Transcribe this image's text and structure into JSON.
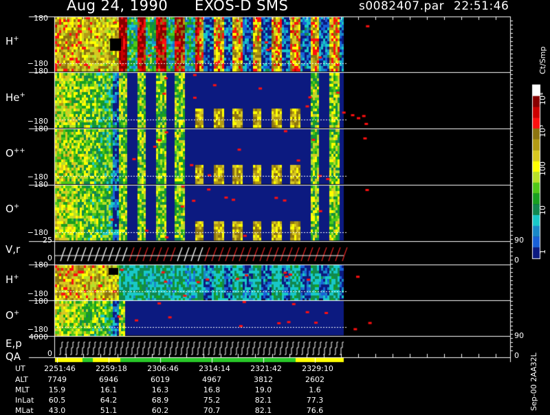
{
  "header": {
    "date": "Aug 24, 1990",
    "instrument": "EXOS-D SMS",
    "file": "s0082407.par",
    "time": "22:51:46"
  },
  "panels": [
    {
      "base": "H",
      "sup": "+",
      "top_tick": "180",
      "bottom_tick": "−180"
    },
    {
      "base": "He",
      "sup": "+",
      "top_tick": "180",
      "bottom_tick": "−180"
    },
    {
      "base": "O",
      "sup": "++",
      "top_tick": "180",
      "bottom_tick": "−180"
    },
    {
      "base": "O",
      "sup": "+",
      "top_tick": "180",
      "bottom_tick": "−180"
    },
    {
      "base": "V,r",
      "sup": "",
      "top_tick": "25",
      "bottom_tick": "0",
      "right_top": "90",
      "right_bottom": "0"
    },
    {
      "base": "H",
      "sup": "+",
      "top_tick": "180",
      "bottom_tick": "−180"
    },
    {
      "base": "O",
      "sup": "+",
      "top_tick": "180",
      "bottom_tick": "−180"
    },
    {
      "base": "E,p",
      "sub": "QA",
      "top_tick": "4000",
      "bottom_tick": "0",
      "right_top": "90",
      "right_bottom": "0"
    }
  ],
  "colorbar": {
    "unit": "Ct/Smp",
    "ticks": [
      "10⁴",
      "10³",
      "100",
      "10",
      "1"
    ],
    "colors": [
      "#ffffff",
      "#880000",
      "#cc0000",
      "#ff1010",
      "#8c7410",
      "#b29a14",
      "#d8c820",
      "#ffff00",
      "#b8e028",
      "#50c818",
      "#18a020",
      "#118850",
      "#18c8c8",
      "#1888c8",
      "#1860d8",
      "#0c1a80"
    ]
  },
  "side_label": "Sep-00  2AA32L",
  "table": {
    "rows": [
      {
        "label": "UT",
        "values": [
          "2251:46",
          "2259:18",
          "2306:46",
          "2314:14",
          "2321:42",
          "2329:10"
        ]
      },
      {
        "label": "ALT",
        "values": [
          "7749",
          "6946",
          "6019",
          "4967",
          "3812",
          "2602"
        ]
      },
      {
        "label": "MLT",
        "values": [
          "15.9",
          "16.1",
          "16.3",
          "16.8",
          "19.0",
          "1.6"
        ]
      },
      {
        "label": "InLat",
        "values": [
          "60.5",
          "64.2",
          "68.9",
          "75.2",
          "82.1",
          "77.3"
        ]
      },
      {
        "label": "MLat",
        "values": [
          "43.0",
          "51.1",
          "60.2",
          "70.7",
          "82.1",
          "76.6"
        ]
      }
    ]
  },
  "chart_data": {
    "type": "heatmap",
    "title": "Aug 24, 1990   EXOS-D SMS   s0082407.par  22:51:46",
    "x": [
      "2251:46",
      "2259:18",
      "2306:46",
      "2314:14",
      "2321:42",
      "2329:10"
    ],
    "series": [
      {
        "name": "H+",
        "ylim": [
          -180,
          180
        ]
      },
      {
        "name": "He+",
        "ylim": [
          -180,
          180
        ]
      },
      {
        "name": "O++",
        "ylim": [
          -180,
          180
        ]
      },
      {
        "name": "O+",
        "ylim": [
          -180,
          180
        ]
      },
      {
        "name": "V,r",
        "ylim": [
          0,
          25
        ],
        "right_ylim": [
          0,
          90
        ]
      },
      {
        "name": "H+",
        "ylim": [
          -180,
          180
        ]
      },
      {
        "name": "O+",
        "ylim": [
          -180,
          180
        ]
      },
      {
        "name": "E,p",
        "ylim": [
          0,
          4000
        ],
        "right_ylim": [
          0,
          90
        ]
      }
    ],
    "colorbar_range": [
      "1",
      "10⁴"
    ],
    "colorbar_unit": "Ct/Smp"
  }
}
